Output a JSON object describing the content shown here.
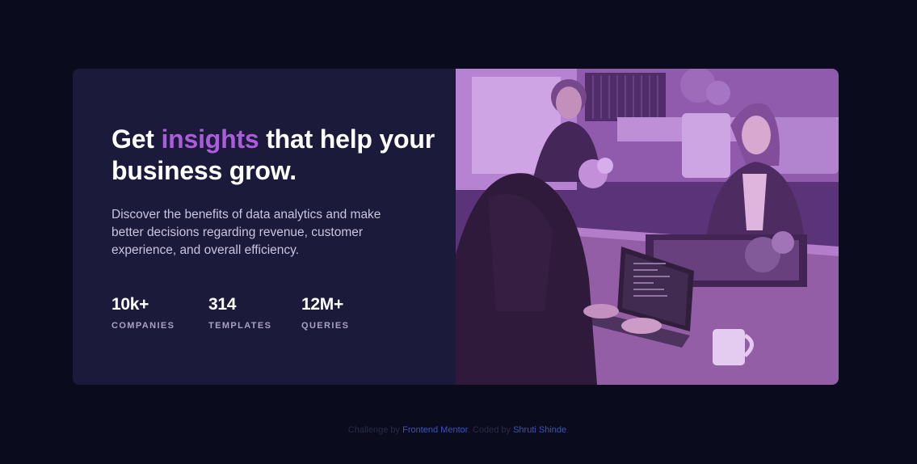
{
  "card": {
    "headline_before": "Get ",
    "headline_highlight": "insights",
    "headline_after": " that help your business grow.",
    "description": "Discover the benefits of data analytics and make better decisions regarding revenue, customer experience, and overall efficiency.",
    "stats": [
      {
        "value": "10k+",
        "label": "COMPANIES"
      },
      {
        "value": "314",
        "label": "TEMPLATES"
      },
      {
        "value": "12M+",
        "label": "QUERIES"
      }
    ],
    "image": {
      "subject": "people working at desks with laptops in office",
      "tint": "#aa5cdb"
    }
  },
  "footer": {
    "challenge_prefix": "Challenge by ",
    "challenge_link": "Frontend Mentor",
    "coded_prefix": ". Coded by ",
    "coded_link": "Shruti Shinde",
    "suffix": "."
  },
  "colors": {
    "page_background": "#0a0c1d",
    "card_background": "#1c1a3a",
    "accent": "#aa5cdb",
    "link": "#3b53c4"
  }
}
